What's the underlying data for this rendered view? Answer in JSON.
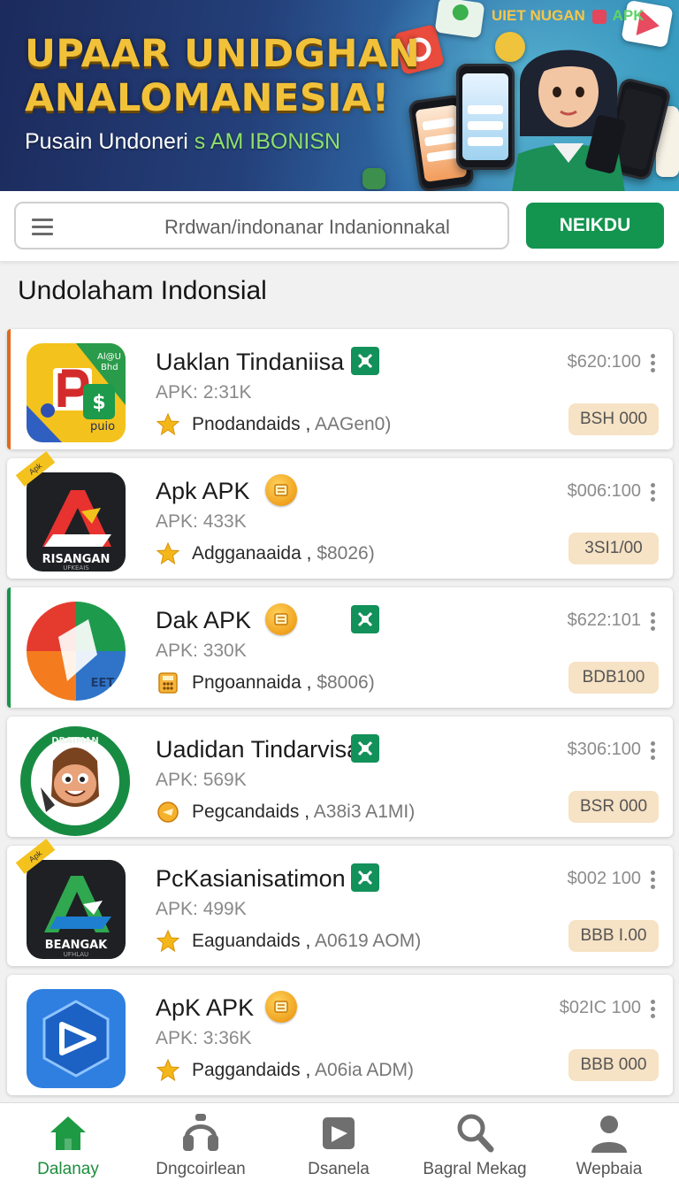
{
  "banner": {
    "title_line1": "UPAAR UNIDGHAN",
    "title_line2": "ANALOMANESIA!",
    "subtitle": "Pusain Undoneri",
    "subtitle_highlight": "s AM IBONISN",
    "tag": "UIET NUGAN",
    "tag_apk": "APK"
  },
  "search": {
    "placeholder": "Rrdwan/indonanar Indanionnakal",
    "button_label": "NEIKDU"
  },
  "section": {
    "title": "Undolaham Indonsial"
  },
  "apps": [
    {
      "name": "Uaklan Tindaniisa",
      "badge": "green",
      "size": "APK: 2:31K",
      "rating_icon": "star-icon",
      "meta": "Pnodandaids ,",
      "meta_extra": "AAGen0)",
      "price": "$620:100",
      "button": "BSH 000",
      "accent": "#e06a1b"
    },
    {
      "name": "Apk  APK",
      "badge": "coin",
      "size": "APK: 433K",
      "rating_icon": "star-icon",
      "meta": "Adgganaaida ,",
      "meta_extra": "$8026)",
      "price": "$006:100",
      "button": "3SI1/00",
      "accent": ""
    },
    {
      "name": "Dak  APK",
      "badge": "coin+green",
      "size": "APK: 330K",
      "rating_icon": "calculator-icon",
      "meta": "Pngoannaida ,",
      "meta_extra": "$8006)",
      "price": "$622:101",
      "button": "BDB100",
      "accent": "#17934c"
    },
    {
      "name": "Uadidan Tindarvisa",
      "badge": "green",
      "size": "APK: 569K",
      "rating_icon": "coin-icon",
      "meta": "Pegcandaids ,",
      "meta_extra": "A38i3 A1MI)",
      "price": "$306:100",
      "button": "BSR 000",
      "accent": ""
    },
    {
      "name": "PcKasianisatimon",
      "badge": "green",
      "size": "APK: 499K",
      "rating_icon": "star-icon",
      "meta": "Eaguandaids ,",
      "meta_extra": "A0619 AOM)",
      "price": "$002 100",
      "button": "BBB I.00",
      "accent": ""
    },
    {
      "name": "ApK  APK",
      "badge": "coin",
      "size": "APK: 3:36K",
      "rating_icon": "star-icon",
      "meta": "Paggandaids ,",
      "meta_extra": "A06ia ADM)",
      "price": "$02IC 100",
      "button": "BBB 000",
      "accent": ""
    }
  ],
  "app_icon_labels": {
    "icon1_top": "Al@U",
    "icon1_top2": "Bhd",
    "icon1_bottom": "puio",
    "icon2_text": "RISANGAN",
    "icon2_sub": "UFKEAIS",
    "icon2_ribbon": "Apk",
    "icon3_text": "EET",
    "icon4_ring": "DRAIMAN",
    "icon5_text": "BEANGAK",
    "icon5_sub": "UFHLAU",
    "icon5_ribbon": "Apk"
  },
  "nav": [
    {
      "label": "Dalanay",
      "icon": "home-icon",
      "active": true
    },
    {
      "label": "Dngcoirlean",
      "icon": "headphones-icon",
      "active": false
    },
    {
      "label": "Dsanela",
      "icon": "media-icon",
      "active": false
    },
    {
      "label": "Bagral Mekag",
      "icon": "search-icon",
      "active": false
    },
    {
      "label": "Wepbaia",
      "icon": "profile-icon",
      "active": false
    }
  ],
  "colors": {
    "primary": "#13944f",
    "banner_gold": "#f2c13a",
    "price_button": "#f6e2c4"
  }
}
